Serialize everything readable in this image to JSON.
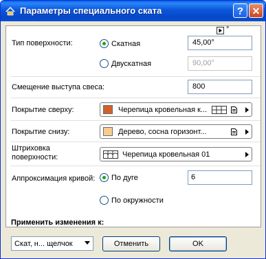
{
  "window": {
    "title": "Параметры специального ската",
    "help_glyph": "?",
    "close_glyph": "✕"
  },
  "angle_unit": "°",
  "surface_type": {
    "label": "Тип поверхности:",
    "option_single": "Скатная",
    "option_double": "Двускатная",
    "selected": "Скатная",
    "single_value": "45,00°",
    "double_value": "90,00°"
  },
  "eave_offset": {
    "label": "Смещение выступа свеса:",
    "value": "800"
  },
  "top_cover": {
    "label": "Покрытие сверху:",
    "value": "Черепица кровельная к...",
    "swatch_color": "#d4602a"
  },
  "bottom_cover": {
    "label": "Покрытие снизу:",
    "value": "Дерево, сосна горизонт...",
    "swatch_color": "#f7cd8f"
  },
  "hatch": {
    "label": "Штриховка поверхности:",
    "value": "Черепица кровельная 01"
  },
  "curve": {
    "label": "Аппроксимация кривой:",
    "option_arc": "По дуге",
    "option_circle": "По окружности",
    "selected": "По дуге",
    "value": "6"
  },
  "apply": {
    "label": "Применить изменения к:",
    "select_value": "Скат, н... щелчок"
  },
  "buttons": {
    "cancel": "Отменить",
    "ok": "OK"
  }
}
